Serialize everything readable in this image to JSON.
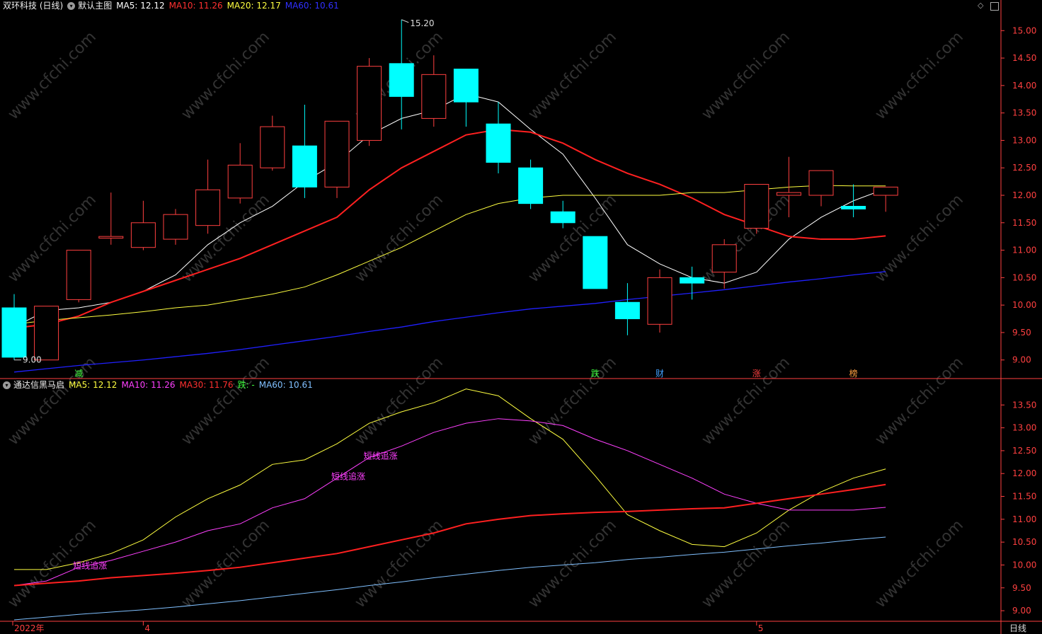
{
  "main_header": {
    "stock": "双环科技 (日线)",
    "panel_name": "默认主图",
    "ma5": "MA5: 12.12",
    "ma10": "MA10: 11.26",
    "ma20": "MA20: 12.17",
    "ma60": "MA60: 10.61"
  },
  "sub_header": {
    "name": "通达信黑马启",
    "ma5": "MA5: 12.12",
    "ma10": "MA10: 11.26",
    "ma30": "MA30: 11.76",
    "die": "跌: -",
    "ma60": "MA60: 10.61"
  },
  "colors": {
    "up": "#ff4040",
    "down": "#00ffff",
    "ma5_main": "#ffffff",
    "ma10_main": "#ff2020",
    "ma20_main": "#ffff40",
    "ma60_main": "#2020ff",
    "ma5_sub": "#ffff40",
    "ma10_sub": "#ff40ff",
    "ma30_sub": "#ff2020",
    "ma60_sub": "#80c0ff",
    "axis": "#ff4040",
    "watermark": "#333333"
  },
  "period_label": "日线",
  "x_labels": [
    "2022年",
    "4",
    "5"
  ],
  "watermark": "www.cfchi.com",
  "chart_data": [
    {
      "type": "candlestick",
      "title": "默认主图",
      "ylim": [
        8.7,
        15.3
      ],
      "yticks": [
        "9.00",
        "9.50",
        "10.00",
        "10.50",
        "11.00",
        "11.50",
        "12.00",
        "12.50",
        "13.00",
        "13.50",
        "14.00",
        "14.50",
        "15.00"
      ],
      "candles": [
        {
          "o": 9.95,
          "h": 10.2,
          "l": 9.0,
          "c": 9.05
        },
        {
          "o": 9.0,
          "h": 9.98,
          "l": 9.0,
          "c": 9.98
        },
        {
          "o": 10.1,
          "h": 11.0,
          "l": 10.05,
          "c": 11.0
        },
        {
          "o": 11.22,
          "h": 12.05,
          "l": 11.1,
          "c": 11.25
        },
        {
          "o": 11.05,
          "h": 11.9,
          "l": 11.0,
          "c": 11.5
        },
        {
          "o": 11.2,
          "h": 11.75,
          "l": 11.1,
          "c": 11.65
        },
        {
          "o": 11.45,
          "h": 12.65,
          "l": 11.3,
          "c": 12.1
        },
        {
          "o": 11.95,
          "h": 12.95,
          "l": 11.85,
          "c": 12.55
        },
        {
          "o": 12.5,
          "h": 13.45,
          "l": 12.45,
          "c": 13.25
        },
        {
          "o": 12.9,
          "h": 13.65,
          "l": 11.95,
          "c": 12.15
        },
        {
          "o": 12.15,
          "h": 13.3,
          "l": 11.95,
          "c": 13.35
        },
        {
          "o": 13.0,
          "h": 14.5,
          "l": 12.9,
          "c": 14.35
        },
        {
          "o": 14.4,
          "h": 15.2,
          "l": 13.2,
          "c": 13.8
        },
        {
          "o": 13.4,
          "h": 14.55,
          "l": 13.25,
          "c": 14.2
        },
        {
          "o": 14.3,
          "h": 14.3,
          "l": 13.25,
          "c": 13.7
        },
        {
          "o": 13.3,
          "h": 13.7,
          "l": 12.4,
          "c": 12.6
        },
        {
          "o": 12.5,
          "h": 12.65,
          "l": 11.75,
          "c": 11.85
        },
        {
          "o": 11.7,
          "h": 11.9,
          "l": 11.4,
          "c": 11.5
        },
        {
          "o": 11.25,
          "h": 11.25,
          "l": 10.3,
          "c": 10.3
        },
        {
          "o": 10.05,
          "h": 10.4,
          "l": 9.45,
          "c": 9.75
        },
        {
          "o": 9.65,
          "h": 10.65,
          "l": 9.5,
          "c": 10.5
        },
        {
          "o": 10.5,
          "h": 10.7,
          "l": 10.1,
          "c": 10.4
        },
        {
          "o": 10.6,
          "h": 11.2,
          "l": 10.3,
          "c": 11.1
        },
        {
          "o": 11.4,
          "h": 12.2,
          "l": 11.3,
          "c": 12.2
        },
        {
          "o": 12.0,
          "h": 12.7,
          "l": 11.6,
          "c": 12.05
        },
        {
          "o": 12.0,
          "h": 12.45,
          "l": 11.8,
          "c": 12.45
        },
        {
          "o": 11.8,
          "h": 12.2,
          "l": 11.6,
          "c": 11.75
        },
        {
          "o": 12.0,
          "h": 12.15,
          "l": 11.7,
          "c": 12.15
        }
      ],
      "series": [
        {
          "name": "MA5",
          "values": [
            9.6,
            9.9,
            9.95,
            10.05,
            10.25,
            10.55,
            11.1,
            11.5,
            11.8,
            12.25,
            12.6,
            13.1,
            13.4,
            13.55,
            13.85,
            13.7,
            13.2,
            12.75,
            11.95,
            11.1,
            10.75,
            10.5,
            10.4,
            10.6,
            11.2,
            11.6,
            11.9,
            12.12
          ]
        },
        {
          "name": "MA10",
          "values": [
            9.58,
            9.65,
            9.8,
            10.05,
            10.25,
            10.45,
            10.65,
            10.85,
            11.1,
            11.35,
            11.6,
            12.1,
            12.5,
            12.8,
            13.1,
            13.2,
            13.15,
            12.95,
            12.65,
            12.4,
            12.2,
            11.95,
            11.65,
            11.45,
            11.25,
            11.2,
            11.2,
            11.26
          ]
        },
        {
          "name": "MA20",
          "values": [
            9.65,
            9.72,
            9.77,
            9.82,
            9.88,
            9.95,
            10.0,
            10.1,
            10.2,
            10.33,
            10.55,
            10.8,
            11.05,
            11.35,
            11.65,
            11.85,
            11.95,
            12.0,
            12.0,
            12.0,
            12.0,
            12.05,
            12.05,
            12.1,
            12.15,
            12.18,
            12.17,
            12.17
          ]
        },
        {
          "name": "MA60",
          "values": [
            8.78,
            8.84,
            8.9,
            8.95,
            9.0,
            9.06,
            9.12,
            9.19,
            9.27,
            9.35,
            9.43,
            9.52,
            9.6,
            9.7,
            9.78,
            9.86,
            9.93,
            9.98,
            10.03,
            10.1,
            10.16,
            10.22,
            10.28,
            10.35,
            10.42,
            10.48,
            10.55,
            10.61
          ]
        }
      ],
      "annotations": {
        "max": "15.20",
        "min": "9.00"
      },
      "markers": [
        {
          "index": 2,
          "label": "减",
          "color": "#40ff40"
        },
        {
          "index": 18,
          "label": "跌",
          "color": "#40ff40"
        },
        {
          "index": 20,
          "label": "财",
          "color": "#40a0ff"
        },
        {
          "index": 23,
          "label": "涨",
          "color": "#ff4040"
        },
        {
          "index": 26,
          "label": "榜",
          "color": "#ffa040"
        }
      ]
    },
    {
      "type": "line",
      "title": "通达信黑马启",
      "ylim": [
        8.8,
        14.0
      ],
      "yticks": [
        "9.00",
        "9.50",
        "10.00",
        "10.50",
        "11.00",
        "11.50",
        "12.00",
        "12.50",
        "13.00",
        "13.50"
      ],
      "series": [
        {
          "name": "MA5",
          "values": [
            9.9,
            9.9,
            10.05,
            10.25,
            10.55,
            11.05,
            11.45,
            11.75,
            12.2,
            12.3,
            12.65,
            13.1,
            13.35,
            13.55,
            13.85,
            13.7,
            13.2,
            12.75,
            11.95,
            11.1,
            10.75,
            10.45,
            10.4,
            10.7,
            11.2,
            11.6,
            11.9,
            12.1
          ]
        },
        {
          "name": "MA10",
          "values": [
            9.55,
            9.65,
            9.95,
            10.1,
            10.3,
            10.5,
            10.75,
            10.9,
            11.25,
            11.45,
            11.9,
            12.35,
            12.6,
            12.9,
            13.1,
            13.2,
            13.15,
            13.05,
            12.75,
            12.5,
            12.2,
            11.9,
            11.55,
            11.35,
            11.2,
            11.2,
            11.2,
            11.26
          ]
        },
        {
          "name": "MA30",
          "values": [
            9.55,
            9.6,
            9.65,
            9.72,
            9.77,
            9.82,
            9.88,
            9.95,
            10.05,
            10.15,
            10.25,
            10.4,
            10.55,
            10.7,
            10.9,
            11.0,
            11.08,
            11.12,
            11.15,
            11.17,
            11.2,
            11.23,
            11.25,
            11.35,
            11.45,
            11.55,
            11.65,
            11.76
          ]
        },
        {
          "name": "MA60",
          "values": [
            8.8,
            8.86,
            8.92,
            8.97,
            9.02,
            9.08,
            9.15,
            9.22,
            9.3,
            9.38,
            9.46,
            9.55,
            9.63,
            9.72,
            9.8,
            9.88,
            9.95,
            10.0,
            10.05,
            10.12,
            10.17,
            10.23,
            10.28,
            10.35,
            10.42,
            10.48,
            10.55,
            10.61
          ]
        }
      ],
      "signals": [
        {
          "index": 2,
          "label": "短线追涨"
        },
        {
          "index": 10,
          "label": "短线追涨"
        },
        {
          "index": 11,
          "label": "短线追涨"
        }
      ]
    }
  ]
}
